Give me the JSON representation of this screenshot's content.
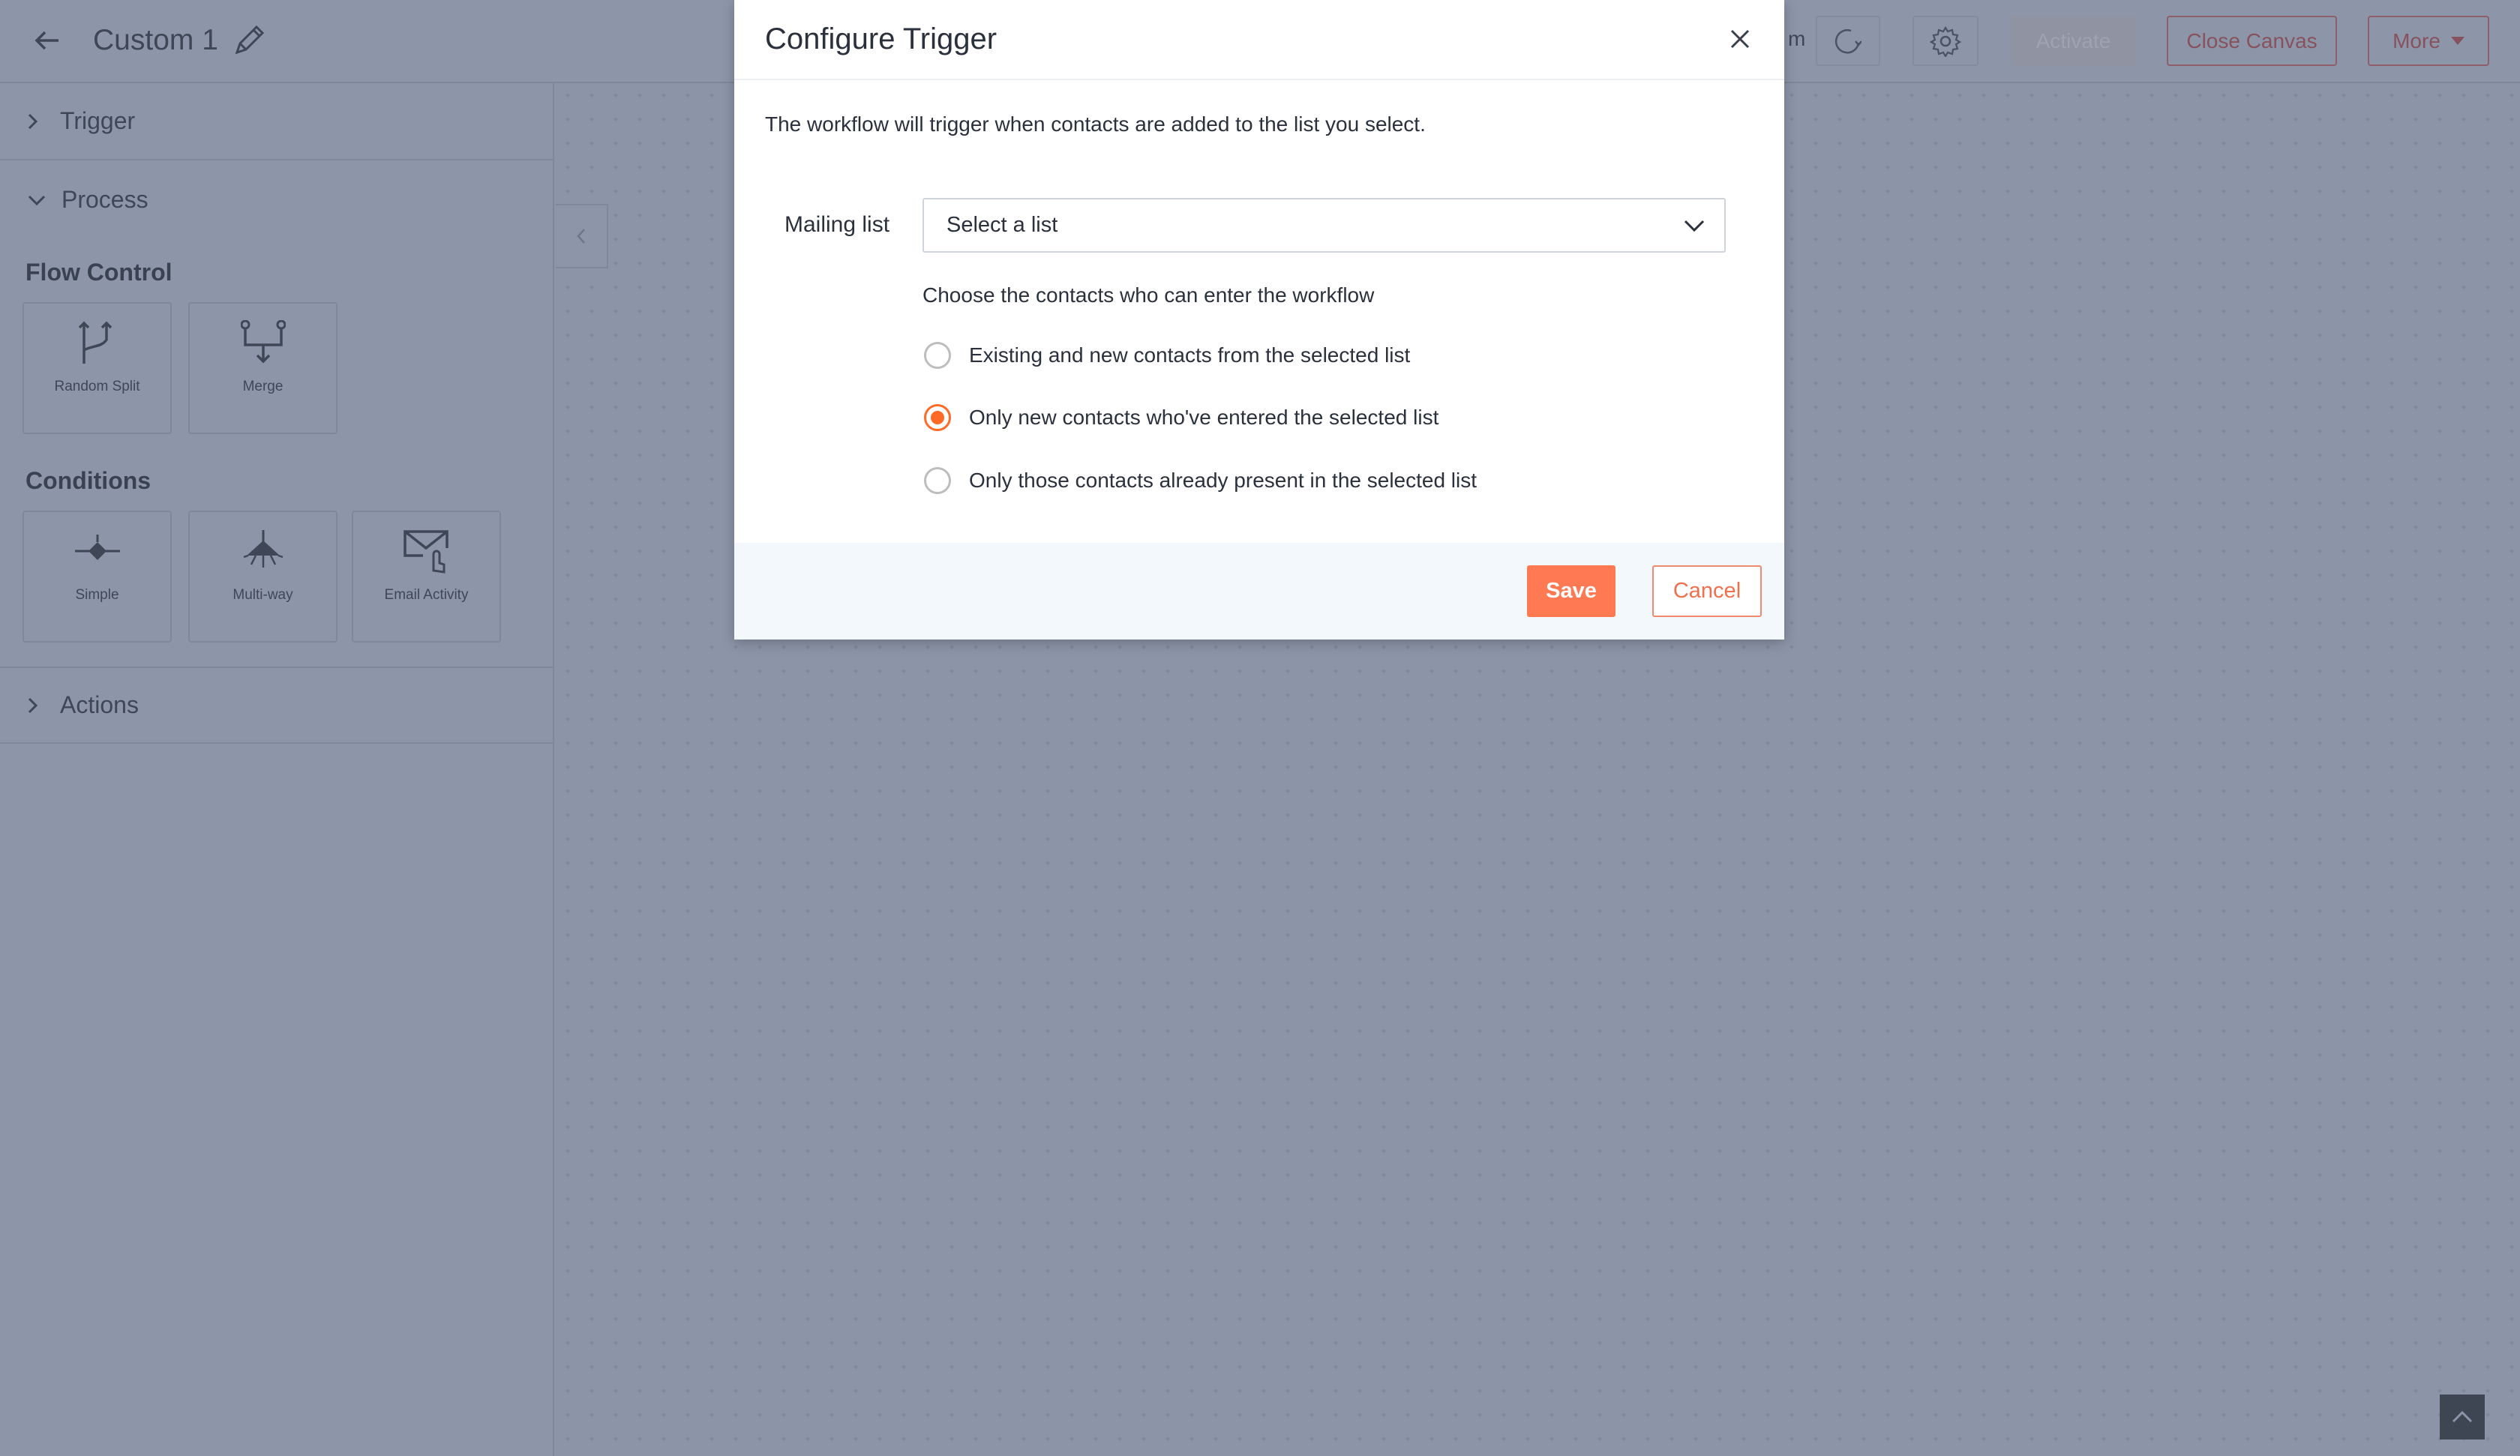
{
  "header": {
    "title": "Custom 1",
    "partial_text": "m",
    "buttons": {
      "activate": "Activate",
      "close_canvas": "Close Canvas",
      "more": "More"
    }
  },
  "sidebar": {
    "trigger": "Trigger",
    "process": "Process",
    "flow_control": {
      "label": "Flow Control",
      "items": [
        "Random Split",
        "Merge"
      ]
    },
    "conditions": {
      "label": "Conditions",
      "items": [
        "Simple",
        "Multi-way",
        "Email Activity"
      ]
    },
    "actions": "Actions"
  },
  "modal": {
    "title": "Configure Trigger",
    "description": "The workflow will trigger when contacts are added to the list you select.",
    "mailing_list_label": "Mailing list",
    "mailing_list_value": "Select a list",
    "choose_label": "Choose the contacts who can enter the workflow",
    "options": [
      {
        "label": "Existing and new contacts from the selected list",
        "selected": false
      },
      {
        "label": "Only new contacts who've entered the selected list",
        "selected": true
      },
      {
        "label": "Only those contacts already present in the selected list",
        "selected": false
      }
    ],
    "save": "Save",
    "cancel": "Cancel"
  },
  "colors": {
    "accent": "#ff7a52",
    "radio_selected": "#ff6a26",
    "overlay": "#8c95a8"
  }
}
